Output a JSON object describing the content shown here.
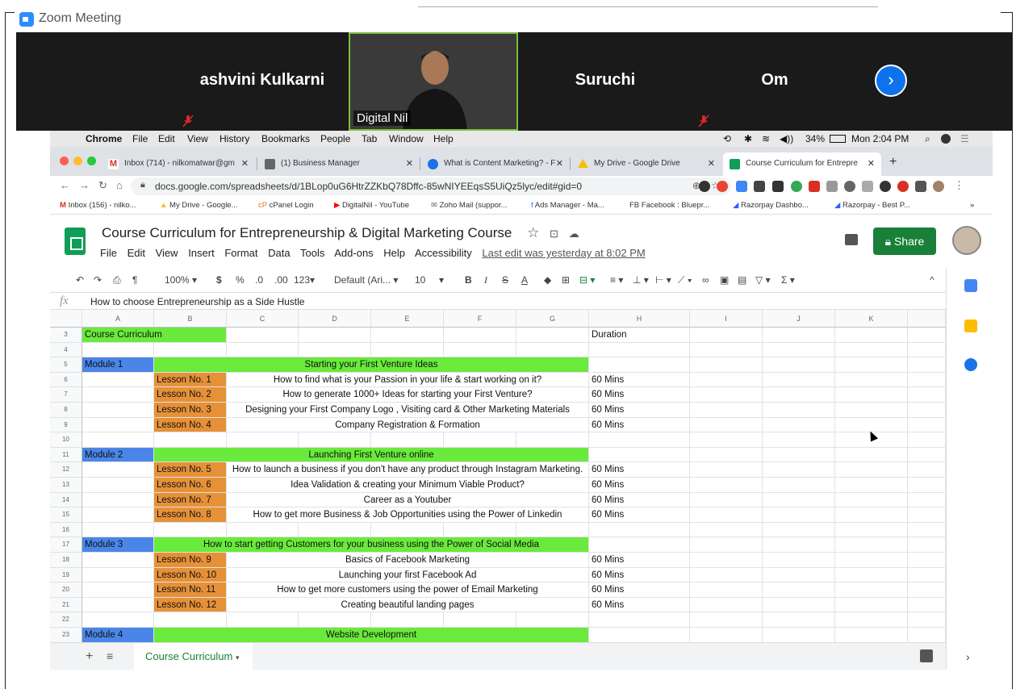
{
  "zoom": {
    "window_title": "Zoom Meeting",
    "participants": [
      {
        "name": "ashvini Kulkarni"
      },
      {
        "name": "Digital Nil"
      },
      {
        "name": "Suruchi"
      },
      {
        "name": "Om"
      }
    ],
    "next_icon": "chevron-right"
  },
  "mac_menu": {
    "app": "Chrome",
    "items": [
      "File",
      "Edit",
      "View",
      "History",
      "Bookmarks",
      "People",
      "Tab",
      "Window",
      "Help"
    ],
    "battery": "34%",
    "clock": "Mon 2:04 PM"
  },
  "tabs": [
    {
      "label": "Inbox (714) - nilkomatwar@gm",
      "color": "#d93025"
    },
    {
      "label": "(1) Business Manager",
      "color": "#555555"
    },
    {
      "label": "What is Content Marketing? - F",
      "color": "#1a73e8"
    },
    {
      "label": "My Drive - Google Drive",
      "color": "#fbbc04"
    },
    {
      "label": "Course Curriculum for Entrepre",
      "color": "#0f9d58"
    }
  ],
  "address": {
    "url": "docs.google.com/spreadsheets/d/1BLop0uG6HtrZZKbQ78Dffc-85wNIYEEqsS5UiQz5lyc/edit#gid=0"
  },
  "bookmarks": [
    "Inbox (156) - nilko...",
    "My Drive - Google...",
    "cPanel Login",
    "DigitalNil - YouTube",
    "Zoho Mail (suppor...",
    "Ads Manager - Ma...",
    "FB  Facebook : Bluepr...",
    "Razorpay Dashbo...",
    "Razorpay - Best P..."
  ],
  "sheet": {
    "title": "Course Curriculum for Entrepreneurship & Digital Marketing Course",
    "menu": [
      "File",
      "Edit",
      "View",
      "Insert",
      "Format",
      "Data",
      "Tools",
      "Add-ons",
      "Help",
      "Accessibility"
    ],
    "last_edit": "Last edit was yesterday at 8:02 PM",
    "share": "Share",
    "toolbar": {
      "zoom": "100%",
      "currency": "$",
      "percent": "%",
      "dec_less": ".0",
      "dec_more": ".00",
      "number_format": "123",
      "font": "Default (Ari...",
      "size": "10"
    },
    "formula_value": "How to choose Entrepreneurship as a Side Hustle",
    "columns": [
      "A",
      "B",
      "C",
      "D",
      "E",
      "F",
      "G",
      "H",
      "I",
      "J",
      "K"
    ],
    "rows": [
      {
        "num": "3",
        "a": "Course Curriculum",
        "lesson": "",
        "topic": "",
        "duration": "Duration",
        "type": "header"
      },
      {
        "num": "4",
        "a": "",
        "lesson": "",
        "topic": "",
        "duration": "",
        "type": "blank"
      },
      {
        "num": "5",
        "a": "Module 1",
        "lesson": "",
        "topic": "Starting your First Venture Ideas",
        "duration": "",
        "type": "module"
      },
      {
        "num": "6",
        "a": "",
        "lesson": "Lesson No. 1",
        "topic": "How to find what is your Passion in your life & start working on it?",
        "duration": "60 Mins",
        "type": "lesson"
      },
      {
        "num": "7",
        "a": "",
        "lesson": "Lesson No. 2",
        "topic": "How to generate 1000+ Ideas for starting your First Venture?",
        "duration": "60 Mins",
        "type": "lesson"
      },
      {
        "num": "8",
        "a": "",
        "lesson": "Lesson No. 3",
        "topic": "Designing your First Company Logo , Visiting card & Other Marketing Materials",
        "duration": "60 Mins",
        "type": "lesson"
      },
      {
        "num": "9",
        "a": "",
        "lesson": "Lesson No. 4",
        "topic": "Company Registration & Formation",
        "duration": "60 Mins",
        "type": "lesson"
      },
      {
        "num": "10",
        "a": "",
        "lesson": "",
        "topic": "",
        "duration": "",
        "type": "blank"
      },
      {
        "num": "11",
        "a": "Module 2",
        "lesson": "",
        "topic": "Launching  First Venture online",
        "duration": "",
        "type": "module"
      },
      {
        "num": "12",
        "a": "",
        "lesson": "Lesson No. 5",
        "topic": "How to launch a business if you don't have any product through Instagram Marketing.",
        "duration": "60 Mins",
        "type": "lesson"
      },
      {
        "num": "13",
        "a": "",
        "lesson": "Lesson No. 6",
        "topic": "Idea Validation & creating your Minimum Viable Product?",
        "duration": "60 Mins",
        "type": "lesson"
      },
      {
        "num": "14",
        "a": "",
        "lesson": "Lesson No. 7",
        "topic": "Career as a Youtuber",
        "duration": "60 Mins",
        "type": "lesson"
      },
      {
        "num": "15",
        "a": "",
        "lesson": "Lesson No. 8",
        "topic": "How to get more Business & Job Opportunities using the Power of Linkedin",
        "duration": "60 Mins",
        "type": "lesson"
      },
      {
        "num": "16",
        "a": "",
        "lesson": "",
        "topic": "",
        "duration": "",
        "type": "blank"
      },
      {
        "num": "17",
        "a": "Module 3",
        "lesson": "",
        "topic": "How to start getting Customers for your business using the Power of Social Media",
        "duration": "",
        "type": "module"
      },
      {
        "num": "18",
        "a": "",
        "lesson": "Lesson No. 9",
        "topic": "Basics of Facebook Marketing",
        "duration": "60 Mins",
        "type": "lesson"
      },
      {
        "num": "19",
        "a": "",
        "lesson": "Lesson No. 10",
        "topic": "Launching your first Facebook Ad",
        "duration": "60 Mins",
        "type": "lesson"
      },
      {
        "num": "20",
        "a": "",
        "lesson": "Lesson No. 11",
        "topic": "How to get more customers using the power of Email Marketing",
        "duration": "60 Mins",
        "type": "lesson"
      },
      {
        "num": "21",
        "a": "",
        "lesson": "Lesson No. 12",
        "topic": "Creating beautiful landing pages",
        "duration": "60 Mins",
        "type": "lesson"
      },
      {
        "num": "22",
        "a": "",
        "lesson": "",
        "topic": "",
        "duration": "",
        "type": "blank"
      },
      {
        "num": "23",
        "a": "Module 4",
        "lesson": "",
        "topic": "Website Development",
        "duration": "",
        "type": "module"
      }
    ],
    "sheet_tab": "Course Curriculum"
  },
  "colors": {
    "module_blue": "#4a86e8",
    "green": "#6aea3c",
    "lesson_orange": "#e69138",
    "share_green": "#188038"
  }
}
